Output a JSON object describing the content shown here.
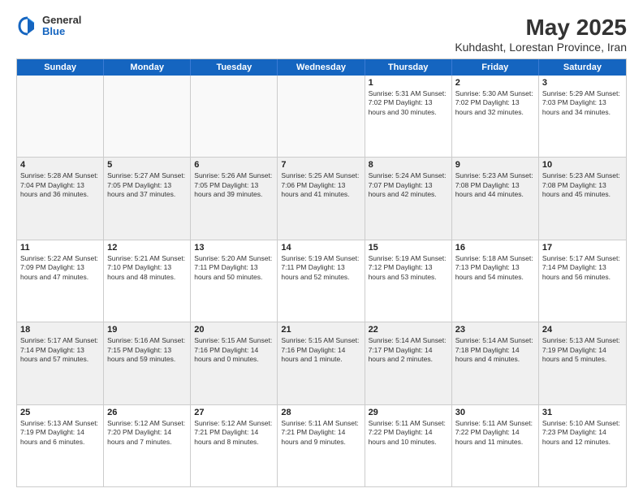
{
  "logo": {
    "general": "General",
    "blue": "Blue"
  },
  "title": "May 2025",
  "subtitle": "Kuhdasht, Lorestan Province, Iran",
  "header_days": [
    "Sunday",
    "Monday",
    "Tuesday",
    "Wednesday",
    "Thursday",
    "Friday",
    "Saturday"
  ],
  "weeks": [
    [
      {
        "day": "",
        "info": ""
      },
      {
        "day": "",
        "info": ""
      },
      {
        "day": "",
        "info": ""
      },
      {
        "day": "",
        "info": ""
      },
      {
        "day": "1",
        "info": "Sunrise: 5:31 AM\nSunset: 7:02 PM\nDaylight: 13 hours\nand 30 minutes."
      },
      {
        "day": "2",
        "info": "Sunrise: 5:30 AM\nSunset: 7:02 PM\nDaylight: 13 hours\nand 32 minutes."
      },
      {
        "day": "3",
        "info": "Sunrise: 5:29 AM\nSunset: 7:03 PM\nDaylight: 13 hours\nand 34 minutes."
      }
    ],
    [
      {
        "day": "4",
        "info": "Sunrise: 5:28 AM\nSunset: 7:04 PM\nDaylight: 13 hours\nand 36 minutes."
      },
      {
        "day": "5",
        "info": "Sunrise: 5:27 AM\nSunset: 7:05 PM\nDaylight: 13 hours\nand 37 minutes."
      },
      {
        "day": "6",
        "info": "Sunrise: 5:26 AM\nSunset: 7:05 PM\nDaylight: 13 hours\nand 39 minutes."
      },
      {
        "day": "7",
        "info": "Sunrise: 5:25 AM\nSunset: 7:06 PM\nDaylight: 13 hours\nand 41 minutes."
      },
      {
        "day": "8",
        "info": "Sunrise: 5:24 AM\nSunset: 7:07 PM\nDaylight: 13 hours\nand 42 minutes."
      },
      {
        "day": "9",
        "info": "Sunrise: 5:23 AM\nSunset: 7:08 PM\nDaylight: 13 hours\nand 44 minutes."
      },
      {
        "day": "10",
        "info": "Sunrise: 5:23 AM\nSunset: 7:08 PM\nDaylight: 13 hours\nand 45 minutes."
      }
    ],
    [
      {
        "day": "11",
        "info": "Sunrise: 5:22 AM\nSunset: 7:09 PM\nDaylight: 13 hours\nand 47 minutes."
      },
      {
        "day": "12",
        "info": "Sunrise: 5:21 AM\nSunset: 7:10 PM\nDaylight: 13 hours\nand 48 minutes."
      },
      {
        "day": "13",
        "info": "Sunrise: 5:20 AM\nSunset: 7:11 PM\nDaylight: 13 hours\nand 50 minutes."
      },
      {
        "day": "14",
        "info": "Sunrise: 5:19 AM\nSunset: 7:11 PM\nDaylight: 13 hours\nand 52 minutes."
      },
      {
        "day": "15",
        "info": "Sunrise: 5:19 AM\nSunset: 7:12 PM\nDaylight: 13 hours\nand 53 minutes."
      },
      {
        "day": "16",
        "info": "Sunrise: 5:18 AM\nSunset: 7:13 PM\nDaylight: 13 hours\nand 54 minutes."
      },
      {
        "day": "17",
        "info": "Sunrise: 5:17 AM\nSunset: 7:14 PM\nDaylight: 13 hours\nand 56 minutes."
      }
    ],
    [
      {
        "day": "18",
        "info": "Sunrise: 5:17 AM\nSunset: 7:14 PM\nDaylight: 13 hours\nand 57 minutes."
      },
      {
        "day": "19",
        "info": "Sunrise: 5:16 AM\nSunset: 7:15 PM\nDaylight: 13 hours\nand 59 minutes."
      },
      {
        "day": "20",
        "info": "Sunrise: 5:15 AM\nSunset: 7:16 PM\nDaylight: 14 hours\nand 0 minutes."
      },
      {
        "day": "21",
        "info": "Sunrise: 5:15 AM\nSunset: 7:16 PM\nDaylight: 14 hours\nand 1 minute."
      },
      {
        "day": "22",
        "info": "Sunrise: 5:14 AM\nSunset: 7:17 PM\nDaylight: 14 hours\nand 2 minutes."
      },
      {
        "day": "23",
        "info": "Sunrise: 5:14 AM\nSunset: 7:18 PM\nDaylight: 14 hours\nand 4 minutes."
      },
      {
        "day": "24",
        "info": "Sunrise: 5:13 AM\nSunset: 7:19 PM\nDaylight: 14 hours\nand 5 minutes."
      }
    ],
    [
      {
        "day": "25",
        "info": "Sunrise: 5:13 AM\nSunset: 7:19 PM\nDaylight: 14 hours\nand 6 minutes."
      },
      {
        "day": "26",
        "info": "Sunrise: 5:12 AM\nSunset: 7:20 PM\nDaylight: 14 hours\nand 7 minutes."
      },
      {
        "day": "27",
        "info": "Sunrise: 5:12 AM\nSunset: 7:21 PM\nDaylight: 14 hours\nand 8 minutes."
      },
      {
        "day": "28",
        "info": "Sunrise: 5:11 AM\nSunset: 7:21 PM\nDaylight: 14 hours\nand 9 minutes."
      },
      {
        "day": "29",
        "info": "Sunrise: 5:11 AM\nSunset: 7:22 PM\nDaylight: 14 hours\nand 10 minutes."
      },
      {
        "day": "30",
        "info": "Sunrise: 5:11 AM\nSunset: 7:22 PM\nDaylight: 14 hours\nand 11 minutes."
      },
      {
        "day": "31",
        "info": "Sunrise: 5:10 AM\nSunset: 7:23 PM\nDaylight: 14 hours\nand 12 minutes."
      }
    ]
  ]
}
